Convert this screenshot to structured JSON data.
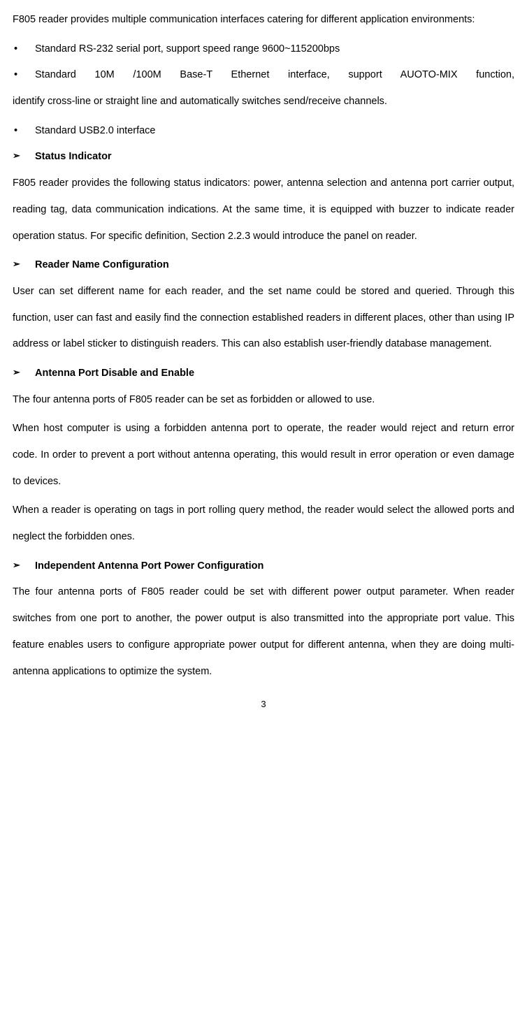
{
  "intro": "F805 reader provides multiple communication interfaces catering for different application environments:",
  "bullet1": "Standard RS-232 serial port, support speed range 9600~115200bps",
  "bullet2a": "Standard 10M /100M Base-T Ethernet interface, support AUOTO-MIX function,",
  "bullet2b": "identify cross-line or straight line and automatically switches send/receive channels.",
  "bullet3": "Standard USB2.0 interface",
  "h1": "Status Indicator",
  "p1": "F805 reader provides the following status indicators: power, antenna selection and antenna port carrier output, reading tag, data communication indications. At the same time, it is equipped with buzzer to indicate reader operation status. For specific definition, Section 2.2.3 would introduce the panel on reader.",
  "h2": "Reader Name Configuration",
  "p2": "User can set different name for each reader, and the set name could be stored and queried. Through this function, user can fast and easily find the connection established readers in different places, other than using IP address or label sticker to distinguish readers. This can also establish user-friendly database management.",
  "h3": "Antenna Port Disable and Enable",
  "p3a": "The four antenna ports of F805 reader can be set as forbidden or allowed to use.",
  "p3b": "When host computer is using a forbidden antenna port to operate, the reader would reject and return error code. In order to prevent a port without antenna operating, this would result in error operation or even damage to devices.",
  "p3c": "When a reader is operating on tags in port rolling query method, the reader would select the allowed ports and neglect the forbidden ones.",
  "h4": "Independent Antenna Port Power Configuration",
  "p4": "The four antenna ports of F805 reader could be set with different power output parameter. When reader switches from one port to another, the power output is also transmitted into the appropriate port value. This feature enables users to configure appropriate power output for different antenna, when they are doing multi-antenna applications to optimize the system.",
  "pageNumber": "3",
  "bulletSymbol": "•",
  "arrowSymbol": "➢"
}
